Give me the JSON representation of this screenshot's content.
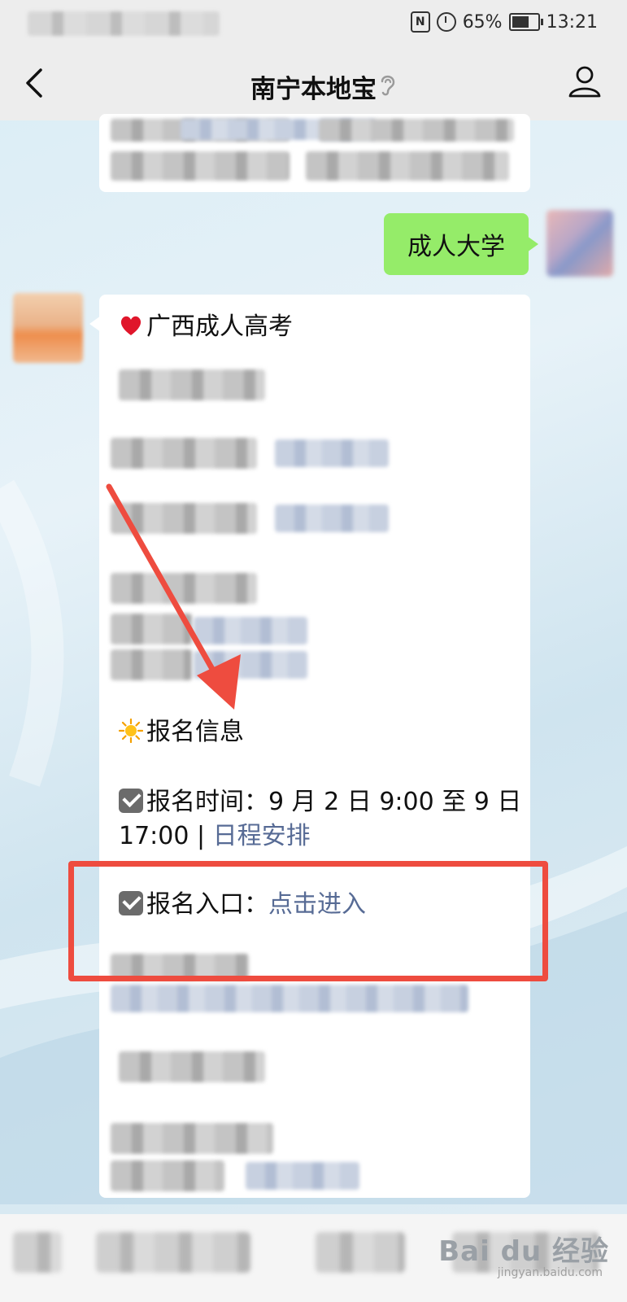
{
  "status_bar": {
    "battery_percent": "65%",
    "time": "13:21",
    "icons": [
      "nfc-icon",
      "alarm-icon",
      "battery-icon"
    ]
  },
  "header": {
    "title": "南宁本地宝",
    "icons": [
      "back-icon",
      "ear-icon",
      "profile-icon"
    ]
  },
  "chat": {
    "sent_message": "成人大学",
    "received": {
      "heading": "广西成人高考",
      "section_title": "报名信息",
      "time_label": "报名时间：",
      "time_value": "9 月 2 日 9:00 至 9 日",
      "time_value_2": "17:00 | ",
      "schedule_link": "日程安排",
      "entry_label": "报名入口：",
      "entry_link": "点击进入"
    }
  },
  "watermark": {
    "text": "Bai du 经验",
    "sub": "jingyan.baidu.com"
  },
  "colors": {
    "highlight_box": "#ee4c3f",
    "link": "#576b95",
    "sent_bubble": "#95ec69"
  }
}
